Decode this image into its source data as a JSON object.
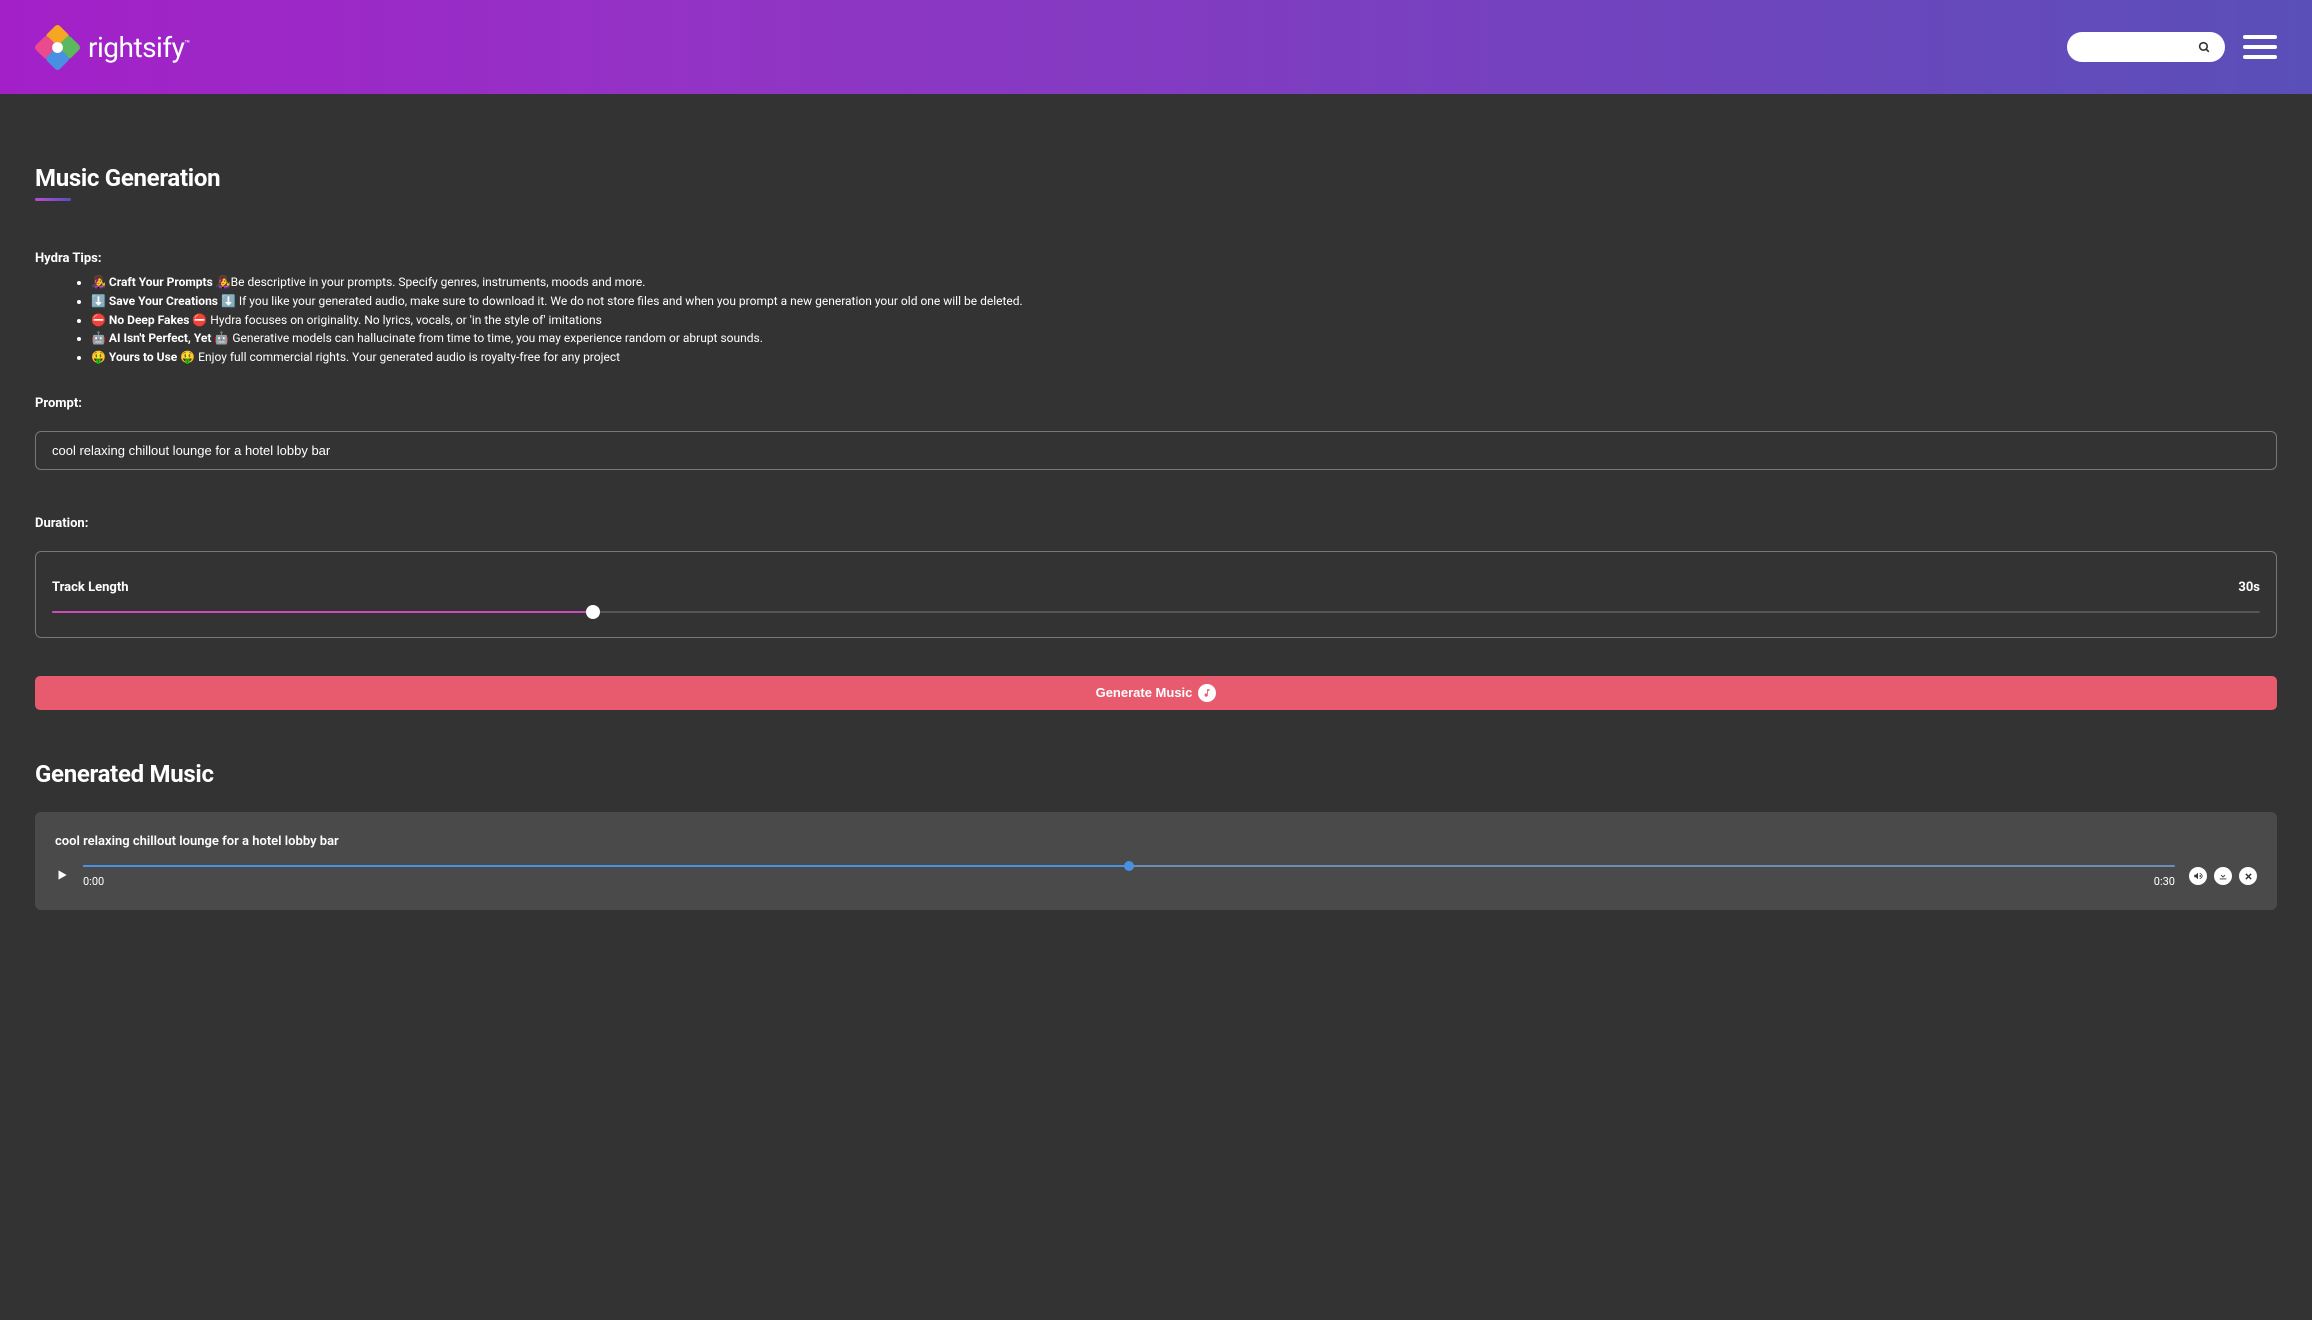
{
  "header": {
    "logo_text": "rightsify",
    "logo_tm": "™"
  },
  "page": {
    "title": "Music Generation",
    "tips_heading": "Hydra Tips:",
    "tips": [
      {
        "prefix": "👩‍🎤 ",
        "bold": "Craft Your Prompts",
        "suffix": " 👩‍🎤Be descriptive in your prompts. Specify genres, instruments, moods and more."
      },
      {
        "prefix": "⬇️ ",
        "bold": "Save Your Creations",
        "suffix": " ⬇️ If you like your generated audio, make sure to download it. We do not store files and when you prompt a new generation your old one will be deleted."
      },
      {
        "prefix": "⛔ ",
        "bold": "No Deep Fakes",
        "suffix": " ⛔ Hydra focuses on originality. No lyrics, vocals, or 'in the style of' imitations"
      },
      {
        "prefix": "🤖 ",
        "bold": "AI Isn't Perfect, Yet",
        "suffix": " 🤖 Generative models can hallucinate from time to time, you may experience random or abrupt sounds."
      },
      {
        "prefix": "🤑 ",
        "bold": "Yours to Use",
        "suffix": " 🤑 Enjoy full commercial rights. Your generated audio is royalty-free for any project"
      }
    ],
    "prompt_label": "Prompt:",
    "prompt_value": "cool relaxing chillout lounge for a hotel lobby bar",
    "duration_label": "Duration:",
    "track_length_label": "Track Length",
    "duration_value": "30s",
    "generate_label": "Generate Music",
    "generated_title": "Generated Music"
  },
  "player": {
    "title": "cool relaxing chillout lounge for a hotel lobby bar",
    "time_current": "0:00",
    "time_total": "0:30"
  }
}
